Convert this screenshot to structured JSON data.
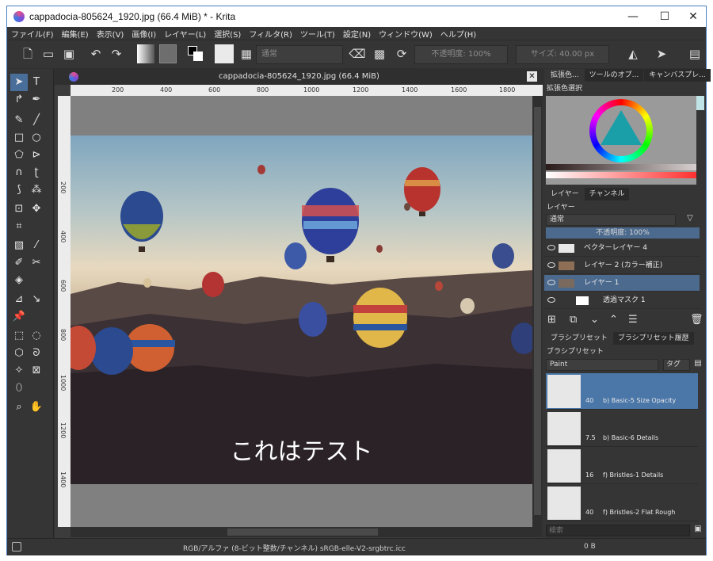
{
  "window": {
    "title": "cappadocia-805624_1920.jpg (66.4 MiB) * - Krita",
    "minimize": "—",
    "maximize": "☐",
    "close": "✕"
  },
  "menu": [
    "ファイル(F)",
    "編集(E)",
    "表示(V)",
    "画像(I)",
    "レイヤー(L)",
    "選択(S)",
    "フィルタ(R)",
    "ツール(T)",
    "設定(N)",
    "ウィンドウ(W)",
    "ヘルプ(H)"
  ],
  "toolbar": {
    "blend_mode": "通常",
    "opacity_label": "不透明度:",
    "opacity_value": "100%",
    "size_label": "サイズ:",
    "size_value": "40.00 px"
  },
  "document": {
    "tab_title": "cappadocia-805624_1920.jpg (66.4 MiB)",
    "canvas_text": "これはテスト"
  },
  "ruler_h": [
    "200",
    "400",
    "600",
    "800",
    "1000",
    "1200",
    "1400",
    "1600",
    "1800"
  ],
  "ruler_v": [
    "200",
    "400",
    "600",
    "800",
    "1000",
    "1200",
    "1400"
  ],
  "dock": {
    "top_tabs": [
      "拡張色...",
      "ツールのオプ...",
      "キャンバスプレ..."
    ],
    "color_panel_title": "拡張色選択",
    "layer_tabs": [
      "レイヤー",
      "チャンネル"
    ],
    "layer_panel_title": "レイヤー",
    "layer_blend": "通常",
    "layer_opacity": "不透明度: 100%",
    "layers": [
      {
        "name": "ベクターレイヤー 4"
      },
      {
        "name": "レイヤー 2 (カラー補正)"
      },
      {
        "name": "レイヤー 1"
      },
      {
        "name": "透過マスク 1"
      }
    ],
    "preset_tabs": [
      "ブラシプリセット",
      "ブラシプリセット履歴"
    ],
    "preset_panel_title": "ブラシプリセット",
    "preset_filter": "Paint",
    "preset_tag": "タグ",
    "presets": [
      {
        "size": "40",
        "name": "b) Basic-5 Size Opacity"
      },
      {
        "size": "7.5",
        "name": "b) Basic-6 Details"
      },
      {
        "size": "16",
        "name": "f) Bristles-1 Details"
      },
      {
        "size": "40",
        "name": "f) Bristles-2 Flat Rough"
      }
    ],
    "search_placeholder": "検索"
  },
  "status": {
    "color_space": "RGB/アルファ (8-ビット整数/チャンネル)  sRGB-elle-V2-srgbtrc.icc",
    "size": "0 B"
  },
  "colors": {
    "accent": "#4a76a8",
    "window_bg": "#303030"
  }
}
